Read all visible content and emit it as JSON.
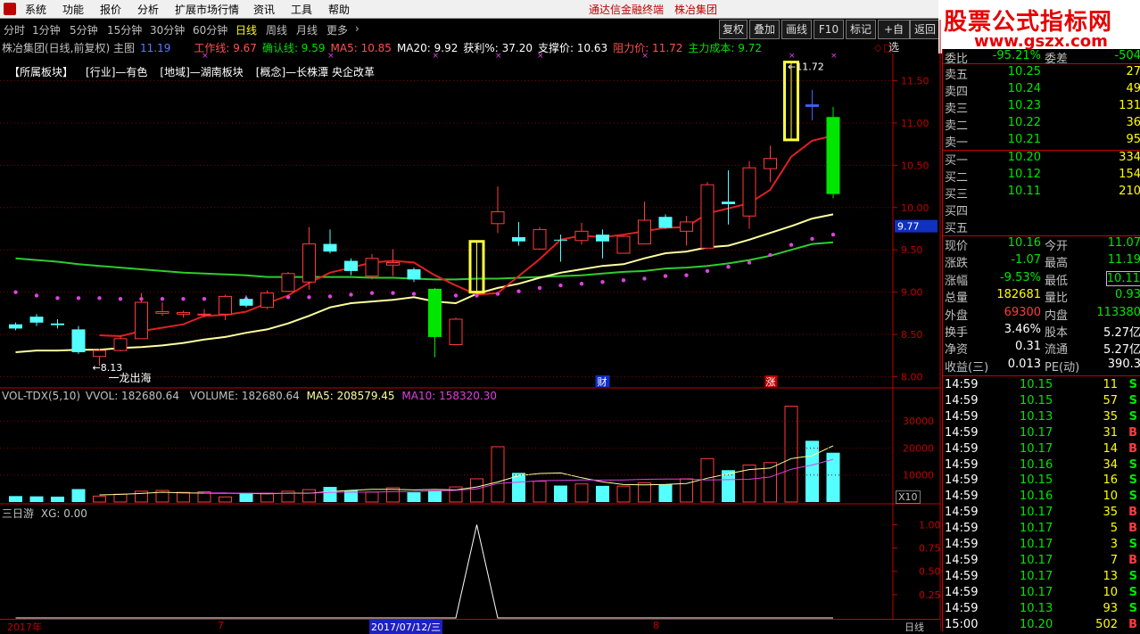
{
  "menu": {
    "items": [
      "系统",
      "功能",
      "报价",
      "分析",
      "扩展市场行情",
      "资讯",
      "工具",
      "帮助"
    ],
    "brand": "通达信金融终端",
    "company": "株冶集团",
    "win_controls": [
      "_",
      "□",
      "×"
    ]
  },
  "logo": {
    "line1": "股票公式指标网",
    "line2": "www.gszx.com"
  },
  "toolbar": {
    "periods": [
      "分时",
      "1分钟",
      "5分钟",
      "15分钟",
      "30分钟",
      "60分钟",
      "日线",
      "周线",
      "月线",
      "更多"
    ],
    "active": "日线",
    "buttons": [
      "复权",
      "叠加",
      "画线",
      "F10",
      "标记",
      "+自选",
      "返回"
    ]
  },
  "info": {
    "title": "株冶集团(日线,前复权) 主图",
    "price": "11.19",
    "work_line": "工作线: 9.67",
    "confirm_line": "确认线: 9.59",
    "ma5": "MA5: 10.85",
    "ma20": "MA20: 9.92",
    "profit": "获利%: 37.20",
    "support": "支撑价: 10.63",
    "resist": "阻力价: 11.72",
    "main_cost": "主力成本: 9.72"
  },
  "sectors": [
    "【所属板块】",
    "[行业]—有色",
    "[地域]—湖南板块",
    "[概念]—长株潭 央企改革"
  ],
  "chart_data": [
    {
      "type": "candlestick",
      "title": "株冶集团(日线,前复权) 主图",
      "ylim": [
        7.9,
        11.8
      ],
      "yticks": [
        "11.50",
        "11.00",
        "10.50",
        "10.00",
        "9.50",
        "9.00",
        "8.50",
        "8.00"
      ],
      "candles": [
        {
          "o": 8.57,
          "c": 8.62,
          "h": 8.64,
          "l": 8.55,
          "color": "cyan"
        },
        {
          "o": 8.64,
          "c": 8.71,
          "h": 8.74,
          "l": 8.6,
          "color": "cyan"
        },
        {
          "o": 8.61,
          "c": 8.63,
          "h": 8.68,
          "l": 8.57,
          "color": "cyan"
        },
        {
          "o": 8.56,
          "c": 8.29,
          "h": 8.6,
          "l": 8.27,
          "color": "cyan"
        },
        {
          "o": 8.31,
          "c": 8.24,
          "h": 8.33,
          "l": 8.13,
          "color": "red"
        },
        {
          "o": 8.31,
          "c": 8.45,
          "h": 8.49,
          "l": 8.3,
          "color": "red"
        },
        {
          "o": 8.45,
          "c": 8.88,
          "h": 8.99,
          "l": 8.45,
          "color": "red"
        },
        {
          "o": 8.75,
          "c": 8.77,
          "h": 8.88,
          "l": 8.72,
          "color": "red"
        },
        {
          "o": 8.74,
          "c": 8.76,
          "h": 8.78,
          "l": 8.7,
          "color": "red"
        },
        {
          "o": 8.73,
          "c": 8.74,
          "h": 8.8,
          "l": 8.7,
          "color": "red"
        },
        {
          "o": 8.74,
          "c": 8.95,
          "h": 8.97,
          "l": 8.67,
          "color": "red"
        },
        {
          "o": 8.92,
          "c": 8.84,
          "h": 8.96,
          "l": 8.82,
          "color": "cyan"
        },
        {
          "o": 8.82,
          "c": 8.99,
          "h": 9.02,
          "l": 8.8,
          "color": "red"
        },
        {
          "o": 9.01,
          "c": 9.22,
          "h": 9.24,
          "l": 9.0,
          "color": "red"
        },
        {
          "o": 9.12,
          "c": 9.57,
          "h": 9.77,
          "l": 9.03,
          "color": "red"
        },
        {
          "o": 9.57,
          "c": 9.48,
          "h": 9.74,
          "l": 9.46,
          "color": "cyan"
        },
        {
          "o": 9.37,
          "c": 9.25,
          "h": 9.4,
          "l": 9.2,
          "color": "cyan"
        },
        {
          "o": 9.19,
          "c": 9.4,
          "h": 9.45,
          "l": 9.15,
          "color": "red"
        },
        {
          "o": 9.32,
          "c": 9.35,
          "h": 9.51,
          "l": 9.19,
          "color": "red"
        },
        {
          "o": 9.27,
          "c": 9.15,
          "h": 9.29,
          "l": 9.12,
          "color": "cyan"
        },
        {
          "o": 9.04,
          "c": 8.47,
          "h": 9.05,
          "l": 8.23,
          "color": "green"
        },
        {
          "o": 8.38,
          "c": 8.68,
          "h": 8.7,
          "l": 8.38,
          "color": "red"
        },
        {
          "o": 9.0,
          "c": 9.6,
          "h": 9.6,
          "l": 9.0,
          "color": "yellow"
        },
        {
          "o": 9.81,
          "c": 9.95,
          "h": 10.25,
          "l": 9.7,
          "color": "red"
        },
        {
          "o": 9.65,
          "c": 9.6,
          "h": 9.83,
          "l": 9.55,
          "color": "cyan"
        },
        {
          "o": 9.51,
          "c": 9.74,
          "h": 9.77,
          "l": 9.5,
          "color": "red"
        },
        {
          "o": 9.62,
          "c": 9.61,
          "h": 9.68,
          "l": 9.36,
          "color": "cyan"
        },
        {
          "o": 9.61,
          "c": 9.72,
          "h": 9.82,
          "l": 9.56,
          "color": "red"
        },
        {
          "o": 9.68,
          "c": 9.6,
          "h": 9.74,
          "l": 9.4,
          "color": "cyan"
        },
        {
          "o": 9.46,
          "c": 9.66,
          "h": 9.67,
          "l": 9.46,
          "color": "red"
        },
        {
          "o": 9.57,
          "c": 9.85,
          "h": 10.07,
          "l": 9.57,
          "color": "red"
        },
        {
          "o": 9.89,
          "c": 9.76,
          "h": 9.92,
          "l": 9.75,
          "color": "cyan"
        },
        {
          "o": 9.72,
          "c": 9.83,
          "h": 9.9,
          "l": 9.55,
          "color": "red"
        },
        {
          "o": 9.52,
          "c": 10.27,
          "h": 10.3,
          "l": 9.52,
          "color": "red"
        },
        {
          "o": 10.07,
          "c": 10.04,
          "h": 10.44,
          "l": 9.8,
          "color": "cyan"
        },
        {
          "o": 9.9,
          "c": 10.47,
          "h": 10.55,
          "l": 9.75,
          "color": "red"
        },
        {
          "o": 10.46,
          "c": 10.58,
          "h": 10.73,
          "l": 10.3,
          "color": "red"
        },
        {
          "o": 10.8,
          "c": 11.72,
          "h": 11.72,
          "l": 10.8,
          "color": "yellow"
        },
        {
          "o": 11.19,
          "c": 11.22,
          "h": 11.39,
          "l": 11.03,
          "color": "blue"
        },
        {
          "o": 11.07,
          "c": 10.16,
          "h": 11.19,
          "l": 10.11,
          "color": "green"
        }
      ],
      "ma_white": [
        8.29,
        8.31,
        8.31,
        8.32,
        8.32,
        8.34,
        8.35,
        8.37,
        8.4,
        8.44,
        8.47,
        8.52,
        8.56,
        8.63,
        8.72,
        8.82,
        8.87,
        8.89,
        8.91,
        8.94,
        8.89,
        8.87,
        8.98,
        9.05,
        9.1,
        9.17,
        9.23,
        9.27,
        9.31,
        9.33,
        9.4,
        9.46,
        9.48,
        9.53,
        9.55,
        9.62,
        9.7,
        9.78,
        9.87,
        9.92
      ],
      "ma_red": [
        null,
        null,
        null,
        null,
        8.49,
        8.48,
        8.54,
        8.58,
        8.62,
        8.72,
        8.73,
        8.77,
        8.87,
        8.96,
        9.11,
        9.23,
        9.29,
        9.35,
        9.37,
        9.35,
        9.2,
        9.08,
        8.97,
        8.99,
        9.19,
        9.39,
        9.62,
        9.67,
        9.65,
        9.68,
        9.72,
        9.76,
        9.77,
        9.93,
        9.99,
        10.05,
        10.21,
        10.6,
        10.79,
        10.85
      ],
      "ma_green": [
        9.4,
        9.38,
        9.36,
        9.33,
        9.31,
        9.29,
        9.27,
        9.25,
        9.23,
        9.22,
        9.21,
        9.2,
        9.18,
        9.18,
        9.18,
        9.18,
        9.18,
        9.17,
        9.17,
        9.16,
        9.15,
        9.15,
        9.16,
        9.16,
        9.17,
        9.18,
        9.19,
        9.2,
        9.22,
        9.24,
        9.25,
        9.28,
        9.29,
        9.31,
        9.34,
        9.38,
        9.43,
        9.5,
        9.57,
        9.59
      ],
      "dots": [
        9.0,
        8.96,
        8.93,
        8.93,
        8.93,
        8.92,
        8.92,
        8.92,
        8.92,
        8.92,
        8.92,
        8.92,
        8.92,
        8.94,
        8.94,
        8.95,
        8.97,
        8.99,
        8.99,
        8.98,
        8.97,
        8.96,
        8.96,
        8.98,
        9.01,
        9.05,
        9.08,
        9.1,
        9.12,
        9.14,
        9.16,
        9.19,
        9.2,
        9.25,
        9.3,
        9.35,
        9.44,
        9.56,
        9.63,
        9.68
      ],
      "annotations": {
        "high": "11.72",
        "low": "8.13",
        "signal": "一龙出海",
        "cost_tag": "9.77",
        "event1": "财",
        "event2": "涨"
      }
    },
    {
      "type": "bar",
      "title": "VOL-TDX(5,10)",
      "legend": {
        "vvol": "VVOL: 182680.64",
        "volume": "VOLUME: 182680.64",
        "ma5": "MA5: 208579.45",
        "ma10": "MA10: 158320.30"
      },
      "unit": "X10",
      "ylim": [
        0,
        38000
      ],
      "yticks": [
        "30000",
        "20000",
        "10000"
      ],
      "values": [
        2200,
        2100,
        2000,
        4800,
        2200,
        2900,
        4000,
        4300,
        3600,
        3800,
        1900,
        3400,
        3300,
        4000,
        4600,
        5600,
        4300,
        3700,
        5300,
        3600,
        4300,
        5600,
        8600,
        20500,
        10800,
        7700,
        6100,
        6700,
        6000,
        5900,
        7100,
        6600,
        8600,
        16100,
        11800,
        13700,
        14600,
        35500,
        22700,
        18268
      ],
      "ma5": [
        null,
        null,
        null,
        null,
        2660,
        2840,
        3180,
        3640,
        3400,
        3320,
        3280,
        3180,
        3080,
        3280,
        3260,
        3860,
        4320,
        4680,
        4700,
        4500,
        4660,
        4500,
        5580,
        7440,
        9760,
        10580,
        10760,
        9000,
        7480,
        6480,
        6340,
        6500,
        6880,
        8820,
        10480,
        12040,
        12600,
        16100,
        17180,
        20860
      ],
      "ma10": [
        null,
        null,
        null,
        null,
        null,
        null,
        null,
        null,
        null,
        3380,
        3360,
        3280,
        3260,
        3160,
        3240,
        3640,
        3680,
        3680,
        3840,
        3860,
        4120,
        4320,
        4880,
        6860,
        7380,
        7900,
        8040,
        8160,
        8140,
        8180,
        8440,
        8500,
        8500,
        8200,
        8300,
        8420,
        9270,
        12170,
        13710,
        15832
      ]
    },
    {
      "type": "line",
      "title": "三日游",
      "legend": "XG: 0.00",
      "ylim": [
        0,
        1.1
      ],
      "yticks": [
        "1.00",
        "0.75",
        "0.50",
        "0.25"
      ],
      "values": [
        0,
        0,
        0,
        0,
        0,
        0,
        0,
        0,
        0,
        0,
        0,
        0,
        0,
        0,
        0,
        0,
        0,
        0,
        0,
        0,
        0,
        0,
        1,
        0,
        0,
        0,
        0,
        0,
        0,
        0,
        0,
        0,
        0,
        0,
        0,
        0,
        0,
        0,
        0,
        0
      ]
    }
  ],
  "bottom_axis": {
    "labels": [
      "2017年",
      "7",
      "2017/07/12/三",
      "8"
    ],
    "period": "日线"
  },
  "quote": {
    "top_partial": {
      "label": "委比",
      "value": "-95.21%",
      "right": "委差",
      "right_value": "-504"
    },
    "asks": [
      {
        "label": "卖五",
        "price": "10.25",
        "vol": "27"
      },
      {
        "label": "卖四",
        "price": "10.24",
        "vol": "49"
      },
      {
        "label": "卖三",
        "price": "10.23",
        "vol": "131"
      },
      {
        "label": "卖二",
        "price": "10.22",
        "vol": "36"
      },
      {
        "label": "卖一",
        "price": "10.21",
        "vol": "95"
      }
    ],
    "bids": [
      {
        "label": "买一",
        "price": "10.20",
        "vol": "334"
      },
      {
        "label": "买二",
        "price": "10.12",
        "vol": "154"
      },
      {
        "label": "买三",
        "price": "10.11",
        "vol": "210"
      },
      {
        "label": "买四",
        "price": "",
        "vol": ""
      },
      {
        "label": "买五",
        "price": "",
        "vol": ""
      }
    ],
    "stats": [
      {
        "l1": "现价",
        "v1": "10.16",
        "c1": "green",
        "l2": "今开",
        "v2": "11.07",
        "c2": "green"
      },
      {
        "l1": "涨跌",
        "v1": "-1.07",
        "c1": "green",
        "l2": "最高",
        "v2": "11.19",
        "c2": "green"
      },
      {
        "l1": "涨幅",
        "v1": "-9.53%",
        "c1": "green",
        "l2": "最低",
        "v2": "10.11",
        "c2": "green"
      },
      {
        "l1": "总量",
        "v1": "182681",
        "c1": "yellow",
        "l2": "量比",
        "v2": "0.93",
        "c2": "green"
      },
      {
        "l1": "外盘",
        "v1": "69300",
        "c1": "red",
        "l2": "内盘",
        "v2": "113380",
        "c2": "green"
      },
      {
        "l1": "换手",
        "v1": "3.46%",
        "c1": "white",
        "l2": "股本",
        "v2": "5.27亿",
        "c2": "white"
      },
      {
        "l1": "净资",
        "v1": "0.31",
        "c1": "white",
        "l2": "流通",
        "v2": "5.27亿",
        "c2": "white"
      },
      {
        "l1": "收益(三)",
        "v1": "0.013",
        "c1": "white",
        "l2": "PE(动)",
        "v2": "390.3",
        "c2": "white"
      }
    ],
    "ticks": [
      {
        "t": "14:59",
        "p": "10.15",
        "v": "11",
        "d": "S"
      },
      {
        "t": "14:59",
        "p": "10.15",
        "v": "57",
        "d": "S"
      },
      {
        "t": "14:59",
        "p": "10.13",
        "v": "35",
        "d": "S"
      },
      {
        "t": "14:59",
        "p": "10.17",
        "v": "31",
        "d": "B"
      },
      {
        "t": "14:59",
        "p": "10.17",
        "v": "14",
        "d": "B"
      },
      {
        "t": "14:59",
        "p": "10.16",
        "v": "34",
        "d": "S"
      },
      {
        "t": "14:59",
        "p": "10.15",
        "v": "16",
        "d": "S"
      },
      {
        "t": "14:59",
        "p": "10.16",
        "v": "10",
        "d": "S"
      },
      {
        "t": "14:59",
        "p": "10.17",
        "v": "35",
        "d": "B"
      },
      {
        "t": "14:59",
        "p": "10.17",
        "v": "5",
        "d": "B"
      },
      {
        "t": "14:59",
        "p": "10.17",
        "v": "3",
        "d": "S"
      },
      {
        "t": "14:59",
        "p": "10.17",
        "v": "7",
        "d": "B"
      },
      {
        "t": "14:59",
        "p": "10.17",
        "v": "13",
        "d": "S"
      },
      {
        "t": "14:59",
        "p": "10.17",
        "v": "10",
        "d": "S"
      },
      {
        "t": "14:59",
        "p": "10.13",
        "v": "93",
        "d": "S"
      },
      {
        "t": "15:00",
        "p": "10.20",
        "v": "502",
        "d": "B"
      }
    ]
  },
  "colors": {
    "up": "#ff3c3c",
    "down_cyan": "#54ffff",
    "down_green": "#00e600",
    "ma_red": "#e02020",
    "ma_white": "#ffffa0",
    "ma_green": "#2ecc2e",
    "dots": "#e040e0",
    "grid": "#800000"
  }
}
